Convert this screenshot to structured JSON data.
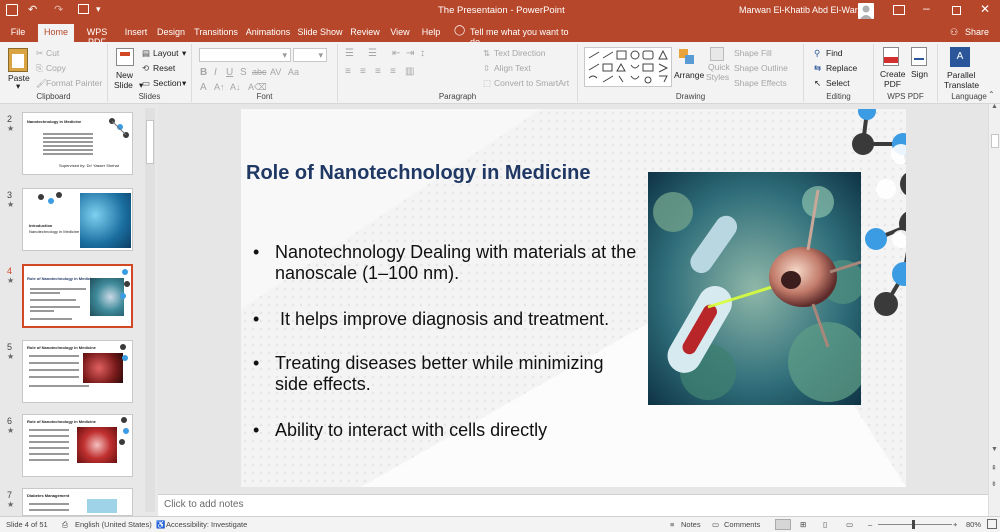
{
  "titlebar": {
    "document_title": "The Presentaion  -  PowerPoint",
    "user_name": "Marwan El-Khatib Abd El-Wares"
  },
  "tabs": [
    "File",
    "Home",
    "WPS PDF",
    "Insert",
    "Design",
    "Transitions",
    "Animations",
    "Slide Show",
    "Review",
    "View",
    "Help"
  ],
  "tell_me": "Tell me what you want to do",
  "share": "Share",
  "ribbon": {
    "clipboard": {
      "paste": "Paste",
      "cut": "Cut",
      "copy": "Copy",
      "format_painter": "Format Painter",
      "label": "Clipboard"
    },
    "slides": {
      "new_slide": "New",
      "new_slide2": "Slide",
      "layout": "Layout",
      "reset": "Reset",
      "section": "Section",
      "label": "Slides"
    },
    "font": {
      "label": "Font"
    },
    "paragraph": {
      "text_direction": "Text Direction",
      "align_text": "Align Text",
      "smartart": "Convert to SmartArt",
      "label": "Paragraph"
    },
    "drawing": {
      "arrange": "Arrange",
      "quick_styles": "Quick",
      "quick_styles2": "Styles",
      "shape_fill": "Shape Fill",
      "shape_outline": "Shape Outline",
      "shape_effects": "Shape Effects",
      "label": "Drawing"
    },
    "editing": {
      "find": "Find",
      "replace": "Replace",
      "select": "Select",
      "label": "Editing"
    },
    "wps": {
      "create_pdf": "Create",
      "create_pdf2": "PDF",
      "sign": "Sign",
      "label": "WPS PDF"
    },
    "language": {
      "parallel": "Parallel",
      "translate": "Translate",
      "label": "Language"
    }
  },
  "thumbnails": [
    {
      "num": "2",
      "title": "Nanotechnology in Medicine",
      "footer": "Supervised by: Dr/ Yasser Shehat"
    },
    {
      "num": "3",
      "title": "Introduction",
      "subtitle": "Nanotechnology in Medicine"
    },
    {
      "num": "4",
      "title": "Role of Nanotechnology in Medicine"
    },
    {
      "num": "5",
      "title": "Role of Nanotechnology in Medicine"
    },
    {
      "num": "6",
      "title": "Role of Nanotechnology in Medicine"
    },
    {
      "num": "7",
      "title": "Diabetes Management"
    }
  ],
  "slide": {
    "title": "Role of Nanotechnology in Medicine",
    "bullets": [
      "Nanotechnology Dealing with materials at the nanoscale (1–100 nm).",
      " It helps improve diagnosis and treatment.",
      "Treating diseases better while minimizing side effects.",
      "Ability to interact with cells directly"
    ]
  },
  "notes_placeholder": "Click to add notes",
  "status": {
    "slide_of": "Slide 4 of 51",
    "language": "English (United States)",
    "accessibility": "Accessibility: Investigate",
    "notes": "Notes",
    "comments": "Comments",
    "zoom": "80%"
  },
  "colors": {
    "accent": "#b7472a",
    "title_text": "#1f3864",
    "molecule_blue": "#3b9be3",
    "molecule_dark": "#3a3a3a"
  }
}
